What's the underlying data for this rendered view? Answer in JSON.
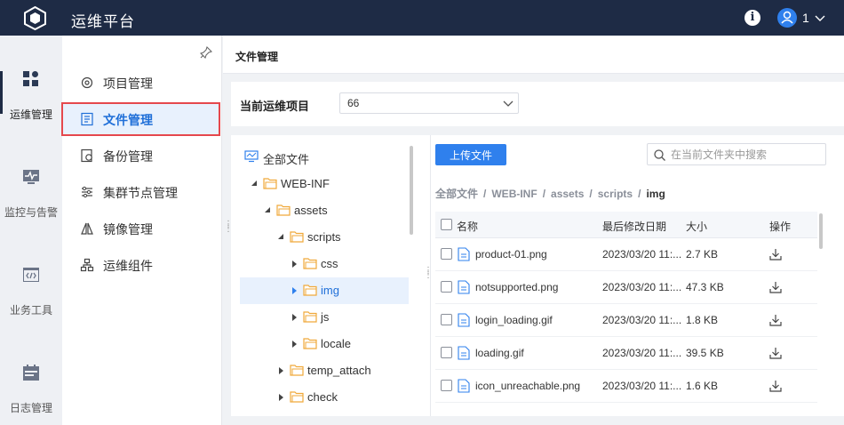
{
  "app": {
    "title": "运维平台",
    "user_name": "1"
  },
  "rail": [
    {
      "label": "运维管理",
      "active": true
    },
    {
      "label": "监控与告警",
      "active": false
    },
    {
      "label": "业务工具",
      "active": false
    },
    {
      "label": "日志管理",
      "active": false
    }
  ],
  "subnav": [
    {
      "label": "项目管理",
      "icon": "gear-icon"
    },
    {
      "label": "文件管理",
      "icon": "document-icon",
      "selected": true
    },
    {
      "label": "备份管理",
      "icon": "backup-icon"
    },
    {
      "label": "集群节点管理",
      "icon": "sliders-icon"
    },
    {
      "label": "镜像管理",
      "icon": "mirror-icon"
    },
    {
      "label": "运维组件",
      "icon": "network-icon"
    }
  ],
  "page": {
    "title": "文件管理",
    "project_label": "当前运维项目",
    "project_value": "66"
  },
  "tree": [
    {
      "label": "全部文件",
      "icon": "monitor-icon",
      "depth": 0,
      "caret": "none"
    },
    {
      "label": "WEB-INF",
      "depth": 1,
      "caret": "down"
    },
    {
      "label": "assets",
      "depth": 2,
      "caret": "down"
    },
    {
      "label": "scripts",
      "depth": 3,
      "caret": "down"
    },
    {
      "label": "css",
      "depth": 4,
      "caret": "right"
    },
    {
      "label": "img",
      "depth": 4,
      "caret": "right",
      "current": true
    },
    {
      "label": "js",
      "depth": 4,
      "caret": "right"
    },
    {
      "label": "locale",
      "depth": 4,
      "caret": "right"
    },
    {
      "label": "temp_attach",
      "depth": 3,
      "caret": "right"
    },
    {
      "label": "check",
      "depth": 3,
      "caret": "right"
    }
  ],
  "files_panel": {
    "upload_label": "上传文件",
    "search_placeholder": "在当前文件夹中搜索",
    "breadcrumb": [
      "全部文件",
      "WEB-INF",
      "assets",
      "scripts",
      "img"
    ],
    "breadcrumb_sep": "/",
    "columns": {
      "name": "名称",
      "modified": "最后修改日期",
      "size": "大小",
      "actions": "操作"
    },
    "rows": [
      {
        "name": "product-01.png",
        "modified": "2023/03/20 11:...",
        "size": "2.7 KB"
      },
      {
        "name": "notsupported.png",
        "modified": "2023/03/20 11:...",
        "size": "47.3 KB"
      },
      {
        "name": "login_loading.gif",
        "modified": "2023/03/20 11:...",
        "size": "1.8 KB"
      },
      {
        "name": "loading.gif",
        "modified": "2023/03/20 11:...",
        "size": "39.5 KB"
      },
      {
        "name": "icon_unreachable.png",
        "modified": "2023/03/20 11:...",
        "size": "1.6 KB"
      }
    ]
  },
  "colors": {
    "topbar": "#1e2b45",
    "accent": "#2f80ed",
    "selected_outline": "#e5484d",
    "folder": "#f0a93b"
  }
}
